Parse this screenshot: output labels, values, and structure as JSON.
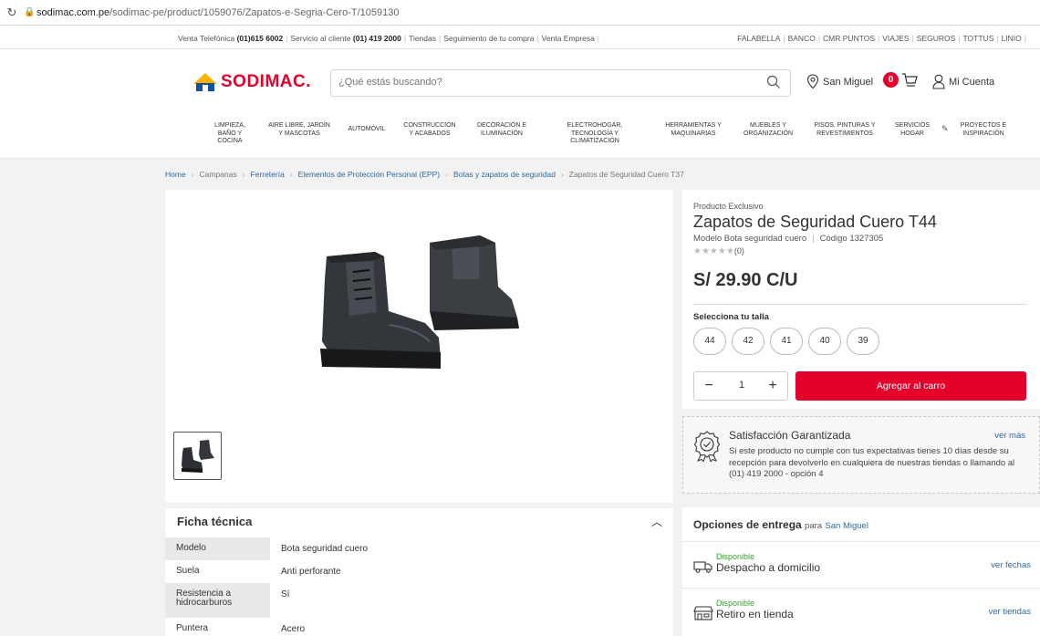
{
  "browser": {
    "url_host": "sodimac.com.pe",
    "url_path": "/sodimac-pe/product/1059076/Zapatos-e-Segria-Cero-T/1059130"
  },
  "topbar": {
    "left": [
      {
        "prefix": "Venta Telefónica ",
        "bold": "(01)615 6002"
      },
      {
        "prefix": "Servicio al cliente ",
        "bold": "(01) 419 2000"
      },
      {
        "prefix": "Tiendas",
        "bold": ""
      },
      {
        "prefix": "Seguimiento de tu compra",
        "bold": ""
      },
      {
        "prefix": "Venta Empresa",
        "bold": ""
      }
    ],
    "right": [
      "FALABELLA",
      "BANCO",
      "CMR PUNTOS",
      "VIAJES",
      "SEGUROS",
      "TOTTUS",
      "LINIO"
    ]
  },
  "header": {
    "logo_text": "SODIMAC.",
    "search_placeholder": "¿Qué estás buscando?",
    "location": "San Miguel",
    "cart_count": "0",
    "account": "Mi Cuenta"
  },
  "nav": [
    {
      "line1": "LIMPIEZA,",
      "line2": "BAÑO Y",
      "line3": "COCINA"
    },
    {
      "line1": "AIRE LIBRE, JARDÍN",
      "line2": "Y MASCOTAS",
      "line3": ""
    },
    {
      "line1": "AUTOMÓVIL",
      "line2": "",
      "line3": ""
    },
    {
      "line1": "CONSTRUCCIÓN",
      "line2": "Y ACABADOS",
      "line3": ""
    },
    {
      "line1": "DECORACIÓN E",
      "line2": "ILUMINACIÓN",
      "line3": ""
    },
    {
      "line1": "ELECTROHOGAR,",
      "line2": "TECNOLOGÍA Y",
      "line3": "CLIMATIZACIÓN"
    },
    {
      "line1": "HERRAMIENTAS Y",
      "line2": "MAQUINARIAS",
      "line3": ""
    },
    {
      "line1": "MUEBLES Y",
      "line2": "ORGANIZACIÓN",
      "line3": ""
    },
    {
      "line1": "PISOS, PINTURAS Y",
      "line2": "REVESTIMIENTOS",
      "line3": ""
    },
    {
      "line1": "SERVICIOS",
      "line2": "HOGAR",
      "line3": ""
    },
    {
      "line1": "PROYECTOS E",
      "line2": "INSPIRACIÓN",
      "line3": ""
    }
  ],
  "breadcrumb": [
    "Home",
    "Campanas",
    "Ferretería",
    "Elementos de Protección Personal (EPP)",
    "Botas y zapatos de seguridad",
    "Zapatos de Seguridad Cuero T37"
  ],
  "product": {
    "exclusive": "Producto Exclusivo",
    "name": "Zapatos de Seguridad Cuero T44",
    "model": "Modelo Bota seguridad cuero",
    "code": "Código 1327305",
    "stars": "★★★★★",
    "rating_count": "(0)",
    "price": "S/ 29.90 C/U",
    "size_label": "Selecciona tu talla",
    "sizes": [
      "44",
      "42",
      "41",
      "40",
      "39"
    ],
    "quantity": "1",
    "add_to_cart": "Agregar al carro"
  },
  "guarantee": {
    "title": "Satisfacción Garantizada",
    "more": "ver más",
    "text": "Si este producto no cumple con tus expectativas tienes 10 días desde su recepción para devolverlo en cualquiera de nuestras tiendas o llamando al (01) 419 2000 - opción 4"
  },
  "delivery": {
    "title": "Opciones de entrega",
    "para": "para",
    "city": "San Miguel",
    "options": [
      {
        "status": "Disponible",
        "name": "Despacho a domicilio",
        "link": "ver fechas"
      },
      {
        "status": "Disponible",
        "name": "Retiro en tienda",
        "link": "ver tiendas"
      }
    ]
  },
  "ficha": {
    "title": "Ficha técnica",
    "rows": [
      {
        "key": "Modelo",
        "value": "Bota seguridad cuero"
      },
      {
        "key": "Suela",
        "value": "Anti perforante"
      },
      {
        "key": "Resistencia a hidrocarburos",
        "value": "Sí"
      },
      {
        "key": "Puntera",
        "value": "Acero"
      }
    ]
  },
  "colors": {
    "brand_red": "#e4002b",
    "link_blue": "#2d6aa0",
    "available_green": "#3aa035"
  }
}
